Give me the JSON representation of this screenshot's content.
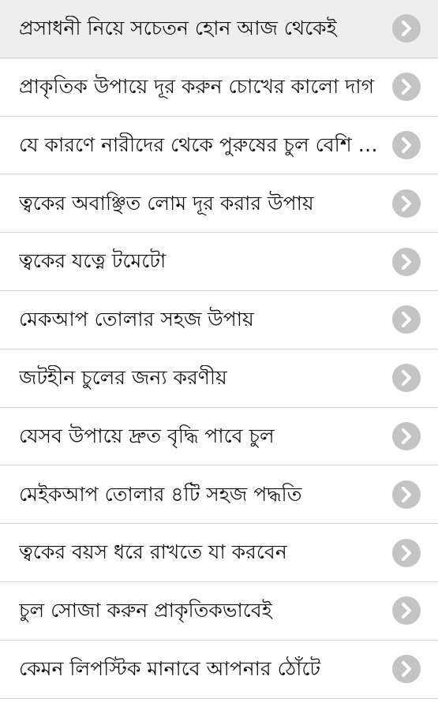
{
  "list": {
    "items": [
      {
        "label": "প্রসাধনী নিয়ে সচেতন হোন আজ থেকেই",
        "icon": "chevron-right-icon",
        "selected": true
      },
      {
        "label": "প্রাকৃতিক উপায়ে দূর করুন চোখের কালো দাগ",
        "icon": "chevron-right-icon",
        "selected": false
      },
      {
        "label": "যে কারণে নারীদের থেকে পুরুষের চুল বেশি পড়ে",
        "icon": "chevron-right-icon",
        "selected": false
      },
      {
        "label": "ত্বকের অবাঞ্ছিত লোম দূর করার উপায়",
        "icon": "chevron-right-icon",
        "selected": false
      },
      {
        "label": "ত্বকের যত্নে টমেটো",
        "icon": "chevron-right-icon",
        "selected": false
      },
      {
        "label": "মেকআপ তোলার সহজ উপায়",
        "icon": "chevron-right-icon",
        "selected": false
      },
      {
        "label": "জটহীন চুলের জন্য করণীয়",
        "icon": "chevron-right-icon",
        "selected": false
      },
      {
        "label": "যেসব উপায়ে দ্রুত বৃদ্ধি পাবে চুল",
        "icon": "chevron-right-icon",
        "selected": false
      },
      {
        "label": "মেইকআপ তোলার ৪টি সহজ পদ্ধতি",
        "icon": "chevron-right-icon",
        "selected": false
      },
      {
        "label": "ত্বকের বয়স ধরে রাখতে যা করবেন",
        "icon": "chevron-right-icon",
        "selected": false
      },
      {
        "label": "চুল সোজা করুন প্রাকৃতিকভাবেই",
        "icon": "chevron-right-icon",
        "selected": false
      },
      {
        "label": "কেমন লিপস্টিক মানাবে আপনার ঠোঁটে",
        "icon": "chevron-right-icon",
        "selected": false
      }
    ]
  },
  "colors": {
    "background": "#ffffff",
    "selected_background": "#eeeeee",
    "divider": "#d4d4d4",
    "chevron_circle": "#c4c4c4",
    "chevron_arrow": "#ffffff",
    "text": "#111111"
  }
}
